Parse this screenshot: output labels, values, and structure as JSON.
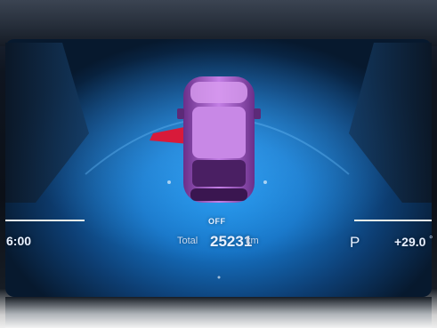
{
  "cluster": {
    "status": "OFF",
    "odometer_label": "Total",
    "odometer_value": "25231",
    "odometer_unit": "km",
    "time": "6:00",
    "gear": "P",
    "temperature": "+29.0",
    "temperature_unit": "°"
  },
  "colors": {
    "glow": "#1c8fe6",
    "car_body": "#b36bd8",
    "open_door_alert": "#d81a3a"
  }
}
